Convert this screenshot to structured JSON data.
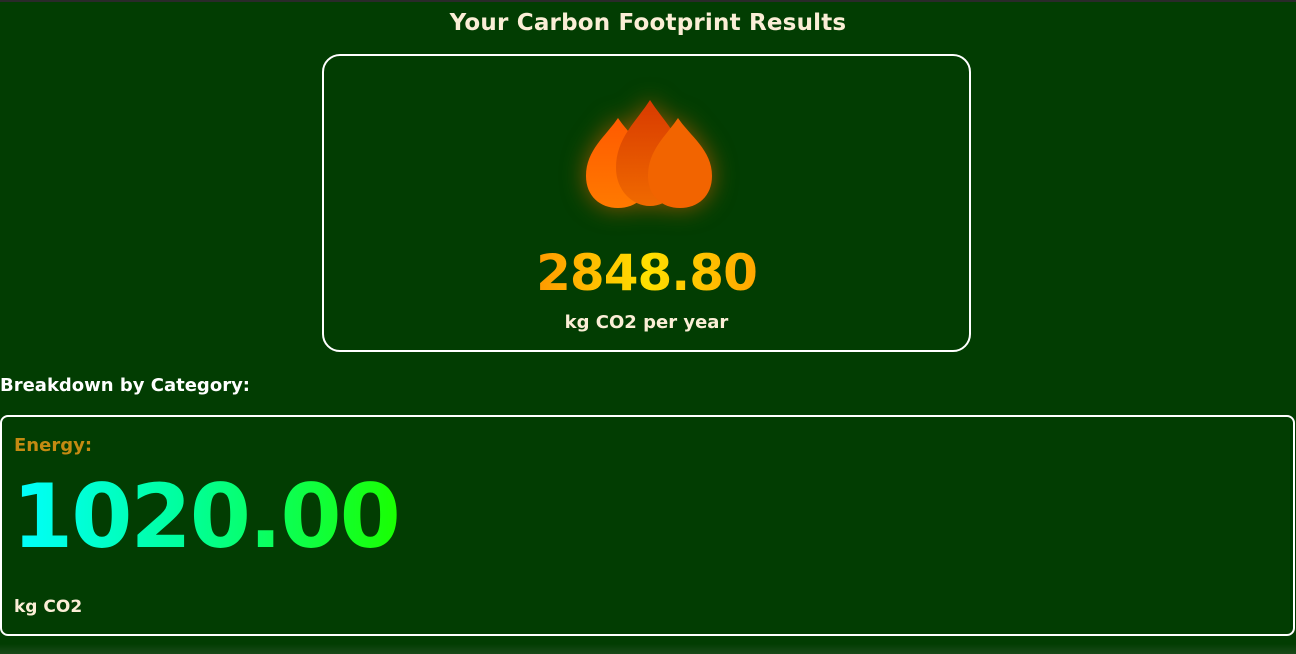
{
  "page": {
    "title": "Your Carbon Footprint Results"
  },
  "total": {
    "value": "2848.80",
    "unit": "kg CO2 per year",
    "icon": "flame-icon"
  },
  "breakdown": {
    "heading": "Breakdown by Category:",
    "categories": [
      {
        "name": "Energy:",
        "value": "1020.00",
        "unit": "kg CO2"
      }
    ]
  },
  "colors": {
    "background": "#023d02",
    "flame": "#ff6a00",
    "category_label": "#c48a12",
    "text": "#fbeed6"
  }
}
